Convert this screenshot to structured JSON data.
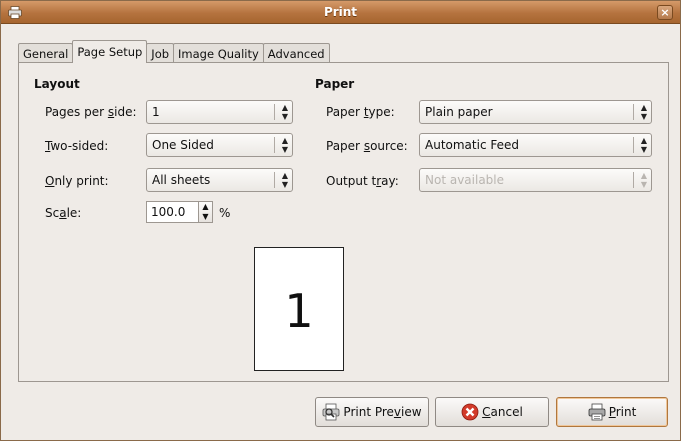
{
  "window": {
    "title": "Print",
    "close_glyph": "×"
  },
  "tabs": [
    {
      "label": "General"
    },
    {
      "label": "Page Setup",
      "active": true
    },
    {
      "label": "Job"
    },
    {
      "label": "Image Quality"
    },
    {
      "label": "Advanced"
    }
  ],
  "layout": {
    "title": "Layout",
    "pages_per_side": {
      "label_pre": "Pages per ",
      "label_ul": "s",
      "label_post": "ide:",
      "value": "1"
    },
    "two_sided": {
      "label_pre": "",
      "label_ul": "T",
      "label_post": "wo-sided:",
      "value": "One Sided"
    },
    "only_print": {
      "label_pre": "",
      "label_ul": "O",
      "label_post": "nly print:",
      "value": "All sheets"
    },
    "scale": {
      "label_pre": "Sc",
      "label_ul": "a",
      "label_post": "le:",
      "value": "100.0",
      "unit": "%"
    }
  },
  "paper": {
    "title": "Paper",
    "paper_type": {
      "label_pre": "Paper ",
      "label_ul": "t",
      "label_post": "ype:",
      "value": "Plain paper"
    },
    "paper_source": {
      "label_pre": "Paper ",
      "label_ul": "s",
      "label_post": "ource:",
      "value": "Automatic Feed"
    },
    "output_tray": {
      "label_pre": "Output t",
      "label_ul": "r",
      "label_post": "ay:",
      "value": "Not available",
      "disabled": true
    }
  },
  "preview": {
    "page_number": "1"
  },
  "buttons": {
    "print_preview": {
      "label_pre": "Print Pre",
      "label_ul": "v",
      "label_post": "iew"
    },
    "cancel": {
      "label_pre": "",
      "label_ul": "C",
      "label_post": "ancel"
    },
    "print": {
      "label_pre": "",
      "label_ul": "P",
      "label_post": "rint"
    }
  },
  "colors": {
    "titlebar": "#b5733f",
    "window_bg": "#efebe7",
    "cancel_icon": "#d23a2a"
  },
  "icons": [
    "printer-icon",
    "close-icon",
    "print-preview-icon",
    "cancel-icon",
    "print-icon"
  ]
}
